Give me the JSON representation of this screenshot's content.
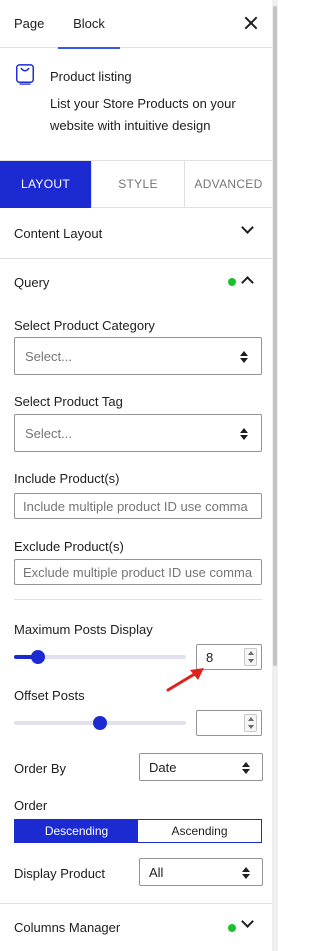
{
  "header": {
    "tabs": [
      "Page",
      "Block"
    ],
    "active_tab": "Block",
    "close_icon": "close-icon"
  },
  "block": {
    "icon": "product-listing-icon",
    "title": "Product listing",
    "description": "List your Store Products on your website with intuitive design"
  },
  "settings_tabs": {
    "layout": "LAYOUT",
    "style": "STYLE",
    "advanced": "ADVANCED",
    "active": "LAYOUT"
  },
  "sections": {
    "content_layout": "Content Layout",
    "query": "Query",
    "columns_manager": "Columns Manager"
  },
  "query": {
    "category_label": "Select Product Category",
    "category_value": "Select...",
    "tag_label": "Select Product Tag",
    "tag_value": "Select...",
    "include_label": "Include Product(s)",
    "include_placeholder": "Include multiple product ID use comma",
    "exclude_label": "Exclude Product(s)",
    "exclude_placeholder": "Exclude multiple product ID use comma",
    "max_posts_label": "Maximum Posts Display",
    "max_posts_value": "8",
    "max_posts_slider_fraction": 0.14,
    "offset_label": "Offset Posts",
    "offset_value": "",
    "offset_slider_fraction": 0.5,
    "order_by_label": "Order By",
    "order_by_value": "Date",
    "order_label": "Order",
    "order_options": [
      "Descending",
      "Ascending"
    ],
    "order_selected": "Descending",
    "display_label": "Display Product",
    "display_value": "All"
  },
  "colors": {
    "accent": "#1b2bd1",
    "status_dot": "#1ac12a",
    "annotation_arrow": "#e0201c"
  }
}
